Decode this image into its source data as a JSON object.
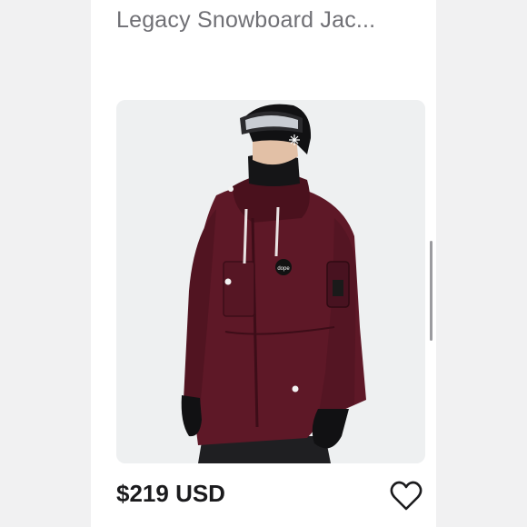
{
  "listing": {
    "title": "Legacy Snowboard Jac...",
    "price": "$219 USD",
    "image_alt": "Burgundy snowboard jacket worn by model with helmet and goggles",
    "brand_patch": "dope"
  },
  "icons": {
    "favorite": "heart-outline-icon"
  },
  "colors": {
    "jacket": "#5e1827",
    "text_title": "#707075",
    "text_price": "#1b1b1d"
  }
}
